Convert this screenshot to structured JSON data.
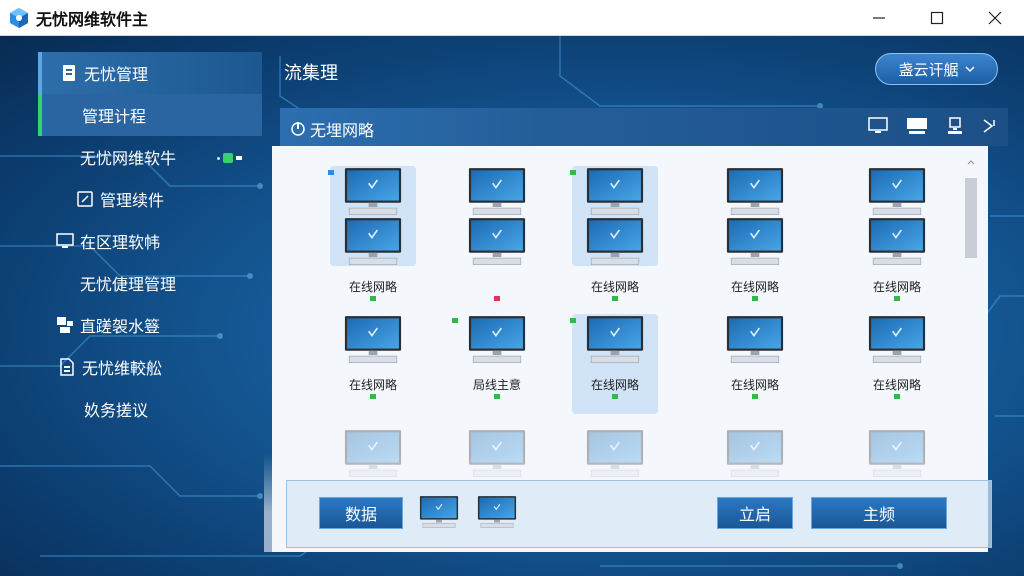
{
  "window": {
    "title": "无忧网维软件主",
    "controls": {
      "minimize": "—",
      "maximize": "☐",
      "close": "✕"
    }
  },
  "sidebar": {
    "items": [
      {
        "label": "无忧管理",
        "icon": "document-icon"
      },
      {
        "label": "管理计程",
        "icon": ""
      },
      {
        "label": "无忧网维软牛",
        "icon": ""
      },
      {
        "label": "管理续件",
        "icon": "edit-icon"
      },
      {
        "label": "在区理软帏",
        "icon": "monitor-icon"
      },
      {
        "label": "无忧倢理管理",
        "icon": ""
      },
      {
        "label": "直蹉袈水簦",
        "icon": "network-icon"
      },
      {
        "label": "无忧维較舩",
        "icon": "file-icon"
      },
      {
        "label": "奺务搓议",
        "icon": ""
      }
    ]
  },
  "header": {
    "title": "流集理",
    "cloud_button": "盏云讦艍"
  },
  "panel": {
    "title": "无埋网略",
    "computers": [
      {
        "label": "在线网略",
        "status_color": "#33b94a"
      },
      {
        "label": "",
        "status_color": "#e0325c"
      },
      {
        "label": "在线网略",
        "status_color": "#33b94a"
      },
      {
        "label": "在线网略",
        "status_color": "#33b94a"
      },
      {
        "label": "在线网略",
        "status_color": "#33b94a"
      },
      {
        "label": "在线网略",
        "status_color": "#33b94a"
      },
      {
        "label": "局线主意",
        "status_color": "#33b94a"
      },
      {
        "label": "在线网略",
        "status_color": "#33b94a"
      },
      {
        "label": "在线网略",
        "status_color": "#33b94a"
      },
      {
        "label": "在线网略",
        "status_color": "#33b94a"
      }
    ]
  },
  "actions": {
    "data_button": "数据",
    "start_button": "立启",
    "main_button": "主频"
  },
  "colors": {
    "accent_green": "#39d073",
    "brand_blue": "#1a5796"
  }
}
